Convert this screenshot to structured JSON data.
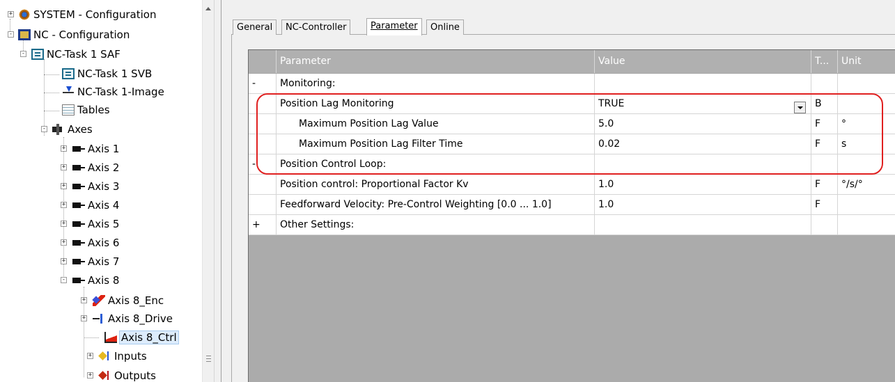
{
  "tree": {
    "items": [
      {
        "label": "SYSTEM - Configuration",
        "icon": "system-config-icon",
        "expander": "+"
      },
      {
        "label": "NC - Configuration",
        "icon": "nc-config-icon",
        "expander": "-"
      },
      {
        "label": "NC-Task 1 SAF",
        "icon": "task-icon",
        "expander": "-"
      },
      {
        "label": "NC-Task 1 SVB",
        "icon": "task-icon"
      },
      {
        "label": "NC-Task 1-Image",
        "icon": "image-icon"
      },
      {
        "label": "Tables",
        "icon": "table-icon"
      },
      {
        "label": "Axes",
        "icon": "axes-icon",
        "expander": "-"
      },
      {
        "label": "Axis 1",
        "icon": "axis-icon",
        "expander": "+"
      },
      {
        "label": "Axis 2",
        "icon": "axis-icon",
        "expander": "+"
      },
      {
        "label": "Axis 3",
        "icon": "axis-icon",
        "expander": "+"
      },
      {
        "label": "Axis 4",
        "icon": "axis-icon",
        "expander": "+"
      },
      {
        "label": "Axis 5",
        "icon": "axis-icon",
        "expander": "+"
      },
      {
        "label": "Axis 6",
        "icon": "axis-icon",
        "expander": "+"
      },
      {
        "label": "Axis 7",
        "icon": "axis-icon",
        "expander": "+"
      },
      {
        "label": "Axis 8",
        "icon": "axis-icon",
        "expander": "-"
      },
      {
        "label": "Axis 8_Enc",
        "icon": "encoder-icon",
        "expander": "+"
      },
      {
        "label": "Axis 8_Drive",
        "icon": "drive-icon",
        "expander": "+"
      },
      {
        "label": "Axis 8_Ctrl",
        "icon": "controller-icon",
        "selected": true
      },
      {
        "label": "Inputs",
        "icon": "inputs-icon",
        "expander": "+"
      },
      {
        "label": "Outputs",
        "icon": "outputs-icon",
        "expander": "+"
      }
    ]
  },
  "tabs": [
    {
      "label": "General"
    },
    {
      "label": "NC-Controller"
    },
    {
      "label": "Parameter",
      "active": true
    },
    {
      "label": "Online"
    }
  ],
  "grid": {
    "headers": {
      "parameter": "Parameter",
      "value": "Value",
      "type": "T...",
      "unit": "Unit"
    },
    "rows": [
      {
        "group": true,
        "toggle": "-",
        "parameter": "Monitoring:",
        "value": "",
        "type": "",
        "unit": ""
      },
      {
        "toggle": "",
        "parameter": "Position Lag Monitoring",
        "value": "TRUE",
        "type": "B",
        "unit": "",
        "combo": true
      },
      {
        "toggle": "",
        "indent": true,
        "parameter": "Maximum Position Lag Value",
        "value": "5.0",
        "type": "F",
        "unit": "°"
      },
      {
        "toggle": "",
        "indent": true,
        "parameter": "Maximum Position Lag Filter Time",
        "value": "0.02",
        "type": "F",
        "unit": "s"
      },
      {
        "group": true,
        "toggle": "-",
        "parameter": "Position Control Loop:",
        "value": "",
        "type": "",
        "unit": ""
      },
      {
        "toggle": "",
        "parameter": "Position control: Proportional Factor Kv",
        "value": "1.0",
        "type": "F",
        "unit": "°/s/°"
      },
      {
        "toggle": "",
        "parameter": "Feedforward Velocity: Pre-Control Weighting [0.0 ... 1.0]",
        "value": "1.0",
        "type": "F",
        "unit": ""
      },
      {
        "group": true,
        "toggle": "+",
        "parameter": "Other Settings:",
        "value": "",
        "type": "",
        "unit": ""
      }
    ]
  },
  "colors": {
    "highlight": "#e02020",
    "selection": "#ddecfc",
    "grid_background": "#ababab"
  }
}
